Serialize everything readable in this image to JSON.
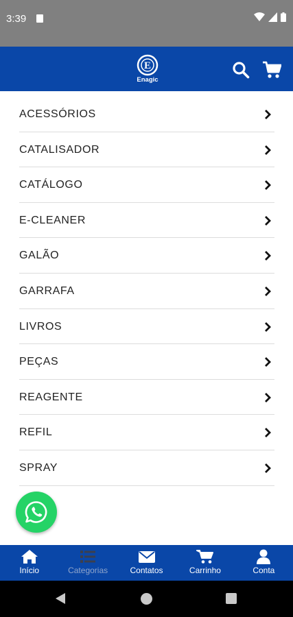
{
  "status_bar": {
    "time": "3:39"
  },
  "header": {
    "logo_icon": "enagic-logo",
    "logo_text": "Enagic",
    "search_icon": "search-icon",
    "cart_icon": "cart-icon",
    "background": "#0a47a8"
  },
  "categories": [
    {
      "label": "ACESSÓRIOS"
    },
    {
      "label": "CATALISADOR"
    },
    {
      "label": "CATÁLOGO"
    },
    {
      "label": "E-CLEANER"
    },
    {
      "label": "GALÃO"
    },
    {
      "label": "GARRAFA"
    },
    {
      "label": "LIVROS"
    },
    {
      "label": "PEÇAS"
    },
    {
      "label": "REAGENTE"
    },
    {
      "label": "REFIL"
    },
    {
      "label": "SPRAY"
    }
  ],
  "whatsapp": {
    "icon": "whatsapp-icon",
    "color": "#25d366"
  },
  "bottom_nav": {
    "items": [
      {
        "label": "Início",
        "icon": "home-icon",
        "active": true
      },
      {
        "label": "Categorias",
        "icon": "list-icon",
        "active": false
      },
      {
        "label": "Contatos",
        "icon": "envelope-icon",
        "active": true
      },
      {
        "label": "Carrinho",
        "icon": "cart-icon",
        "active": true
      },
      {
        "label": "Conta",
        "icon": "user-icon",
        "active": true
      }
    ]
  }
}
